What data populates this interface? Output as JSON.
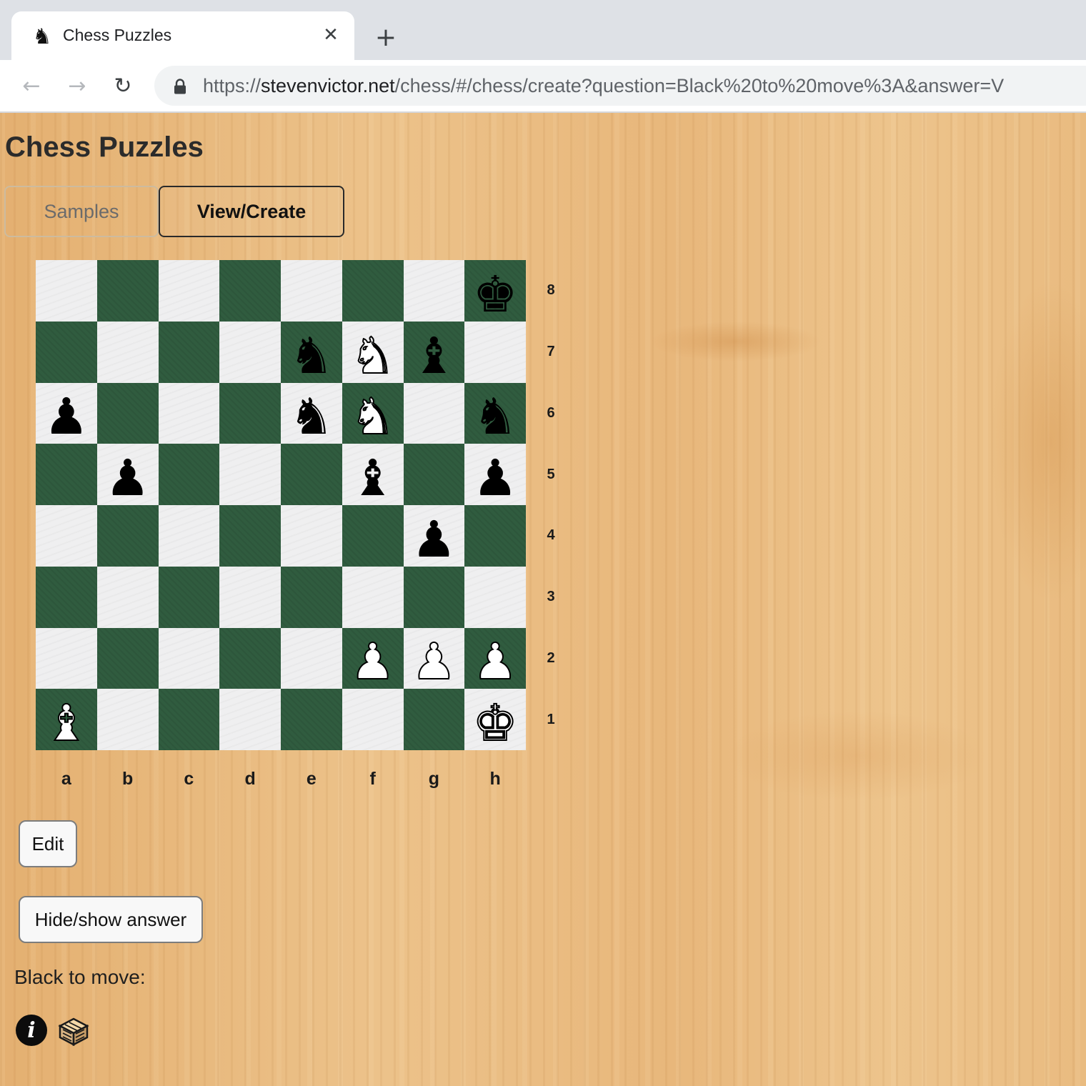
{
  "browser": {
    "tab_title": "Chess Puzzles",
    "tab_icon": "chess-knight-favicon",
    "close_glyph": "✕",
    "new_tab_glyph": "+",
    "back_glyph": "←",
    "forward_glyph": "→",
    "reload_glyph": "↻",
    "url_scheme": "https://",
    "url_host": "stevenvictor.net",
    "url_path": "/chess/#/chess/create?question=Black%20to%20move%3A&answer=V"
  },
  "page": {
    "title": "Chess Puzzles",
    "tabs": [
      {
        "label": "Samples",
        "active": false
      },
      {
        "label": "View/Create",
        "active": true
      }
    ]
  },
  "board": {
    "colors": {
      "light": "#efeff0",
      "dark": "#305c3f"
    },
    "files": [
      "a",
      "b",
      "c",
      "d",
      "e",
      "f",
      "g",
      "h"
    ],
    "ranks": [
      "8",
      "7",
      "6",
      "5",
      "4",
      "3",
      "2",
      "1"
    ],
    "rows": [
      [
        "",
        "",
        "",
        "",
        "",
        "",
        "",
        "bk"
      ],
      [
        "",
        "",
        "",
        "",
        "bn",
        "wn",
        "bb",
        ""
      ],
      [
        "bp",
        "",
        "",
        "",
        "bn",
        "wn",
        "",
        "bn"
      ],
      [
        "",
        "bp",
        "",
        "",
        "",
        "bb",
        "",
        "bp"
      ],
      [
        "",
        "",
        "",
        "",
        "",
        "",
        "bp",
        ""
      ],
      [
        "",
        "",
        "",
        "",
        "",
        "",
        "",
        ""
      ],
      [
        "",
        "",
        "",
        "",
        "",
        "wp",
        "wp",
        "wp"
      ],
      [
        "wb",
        "",
        "",
        "",
        "",
        "",
        "",
        "wk"
      ]
    ]
  },
  "controls": {
    "edit_label": "Edit",
    "hide_show_label": "Hide/show answer"
  },
  "question": "Black to move:",
  "footer_icons": {
    "info": "i",
    "info_icon": "info-icon",
    "lichess_icon": "lichess-icon"
  }
}
